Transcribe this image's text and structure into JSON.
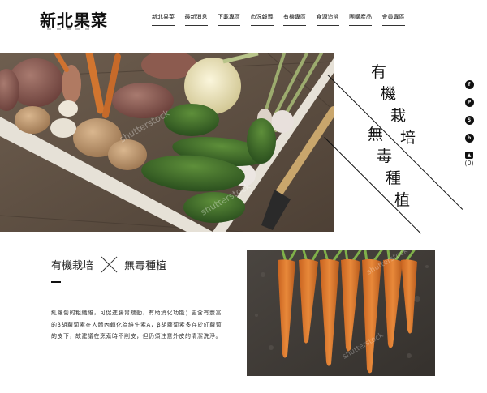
{
  "brand": {
    "name": "新北果菜"
  },
  "nav": [
    {
      "label": "新北果菜"
    },
    {
      "label": "最新消息"
    },
    {
      "label": "下載專區"
    },
    {
      "label": "市況報導"
    },
    {
      "label": "有機專區"
    },
    {
      "label": "食源追溯"
    },
    {
      "label": "團購產品"
    },
    {
      "label": "會員專區"
    }
  ],
  "hero": {
    "tagline_col1": [
      "有",
      "機",
      "栽",
      "培"
    ],
    "tagline_col2": [
      "無",
      "毒",
      "種",
      "植"
    ],
    "watermark": "shutterstock"
  },
  "social": {
    "icons": [
      "facebook-icon",
      "pinterest-icon",
      "skype-icon",
      "blog-icon",
      "cart-icon"
    ],
    "cart_count": "(0)"
  },
  "section": {
    "title_left": "有機栽培",
    "title_right": "無毒種植",
    "body": "紅蘿蔔的粗纖維，可促進腸胃蠕動，有助消化功能；更含有豐富的β胡蘿蔔素在人體內轉化為維生素A，β胡蘿蔔素多存於紅蘿蔔的皮下，故建議在烹煮時不削皮，但仍須注意外皮的清潔洗淨。"
  },
  "colors": {
    "accent": "#111111",
    "wood": "#5b4a3b",
    "carrot": "#d97a2b"
  }
}
